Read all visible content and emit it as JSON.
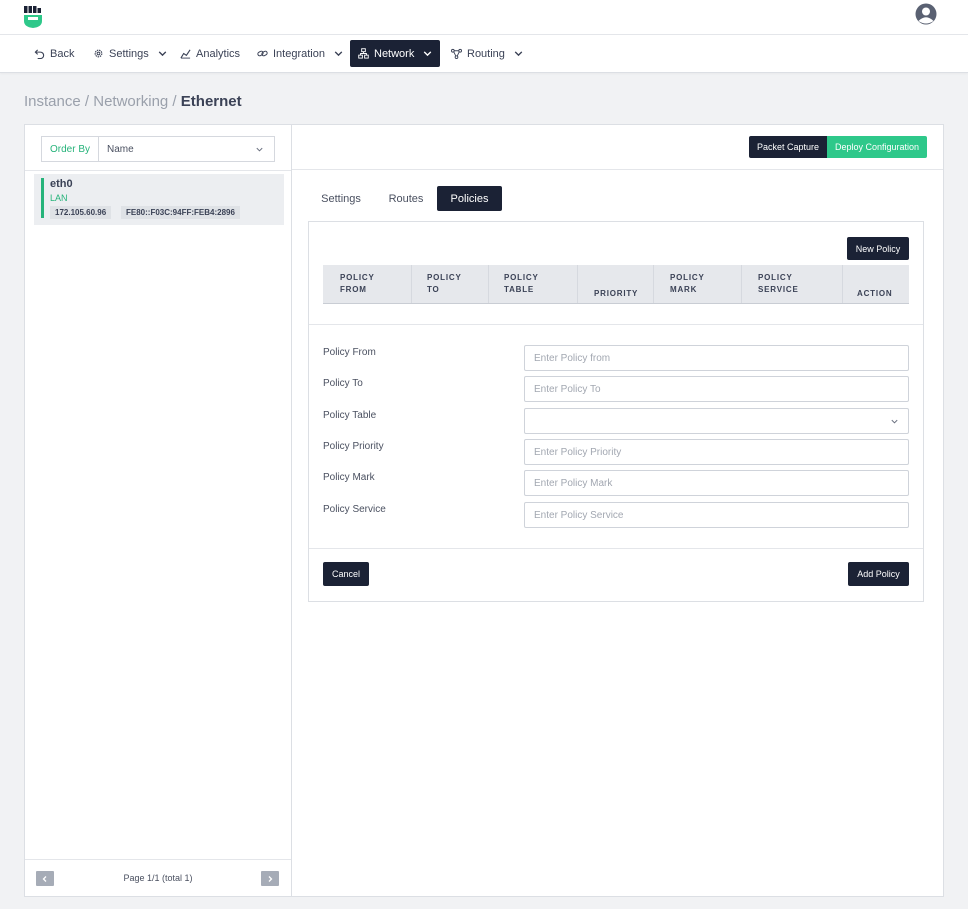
{
  "header": {
    "logo_icon": "fist-logo-icon",
    "avatar_icon": "user-avatar-icon"
  },
  "nav": {
    "items": [
      {
        "label": "Back",
        "icon": "undo-icon"
      },
      {
        "label": "Settings",
        "icon": "gear-icon"
      },
      {
        "label": "Analytics",
        "icon": "chart-icon"
      },
      {
        "label": "Integration",
        "icon": "link-icon"
      },
      {
        "label": "Network",
        "icon": "network-icon",
        "active": true
      },
      {
        "label": "Routing",
        "icon": "route-icon"
      }
    ]
  },
  "breadcrumb": {
    "part1": "Instance",
    "sep1": " / ",
    "part2": "Networking",
    "sep2": " / ",
    "current": "Ethernet"
  },
  "sidebar": {
    "order_by_label": "Order By",
    "order_by_value": "Name",
    "interfaces": [
      {
        "name": "eth0",
        "type": "LAN",
        "ipv4": "172.105.60.96",
        "ipv6": "FE80::F03C:94FF:FEB4:2896"
      }
    ],
    "pager_text": "Page 1/1 (total 1)"
  },
  "main": {
    "packet_capture_label": "Packet Capture",
    "deploy_label": "Deploy Configuration",
    "tabs": [
      {
        "label": "Settings"
      },
      {
        "label": "Routes"
      },
      {
        "label": "Policies",
        "active": true
      }
    ],
    "new_policy_label": "New Policy",
    "table_headers": [
      {
        "line1": "POLICY",
        "line2": "FROM"
      },
      {
        "line1": "POLICY",
        "line2": "TO"
      },
      {
        "line1": "POLICY",
        "line2": "TABLE"
      },
      {
        "line1": "",
        "line2": "PRIORITY"
      },
      {
        "line1": "POLICY",
        "line2": "MARK"
      },
      {
        "line1": "POLICY",
        "line2": "SERVICE"
      },
      {
        "line1": "",
        "line2": "ACTION"
      }
    ],
    "form": {
      "fields": [
        {
          "label": "Policy From",
          "placeholder": "Enter Policy from",
          "value": ""
        },
        {
          "label": "Policy To",
          "placeholder": "Enter Policy To",
          "value": ""
        },
        {
          "label": "Policy Table",
          "placeholder": "",
          "value": ""
        },
        {
          "label": "Policy Priority",
          "placeholder": "Enter Policy Priority",
          "value": ""
        },
        {
          "label": "Policy Mark",
          "placeholder": "Enter Policy Mark",
          "value": ""
        },
        {
          "label": "Policy Service",
          "placeholder": "Enter Policy Service",
          "value": ""
        }
      ]
    },
    "cancel_label": "Cancel",
    "add_policy_label": "Add Policy"
  },
  "colors": {
    "accent_green": "#2ec88a",
    "dark_navy": "#1b2235",
    "background": "#f1f2f4"
  }
}
